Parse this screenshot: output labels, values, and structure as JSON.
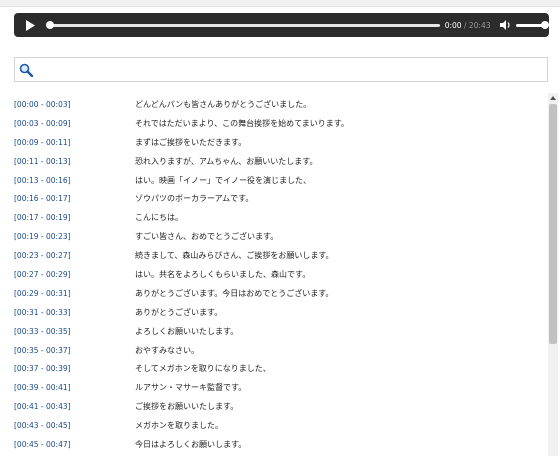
{
  "player": {
    "current_time": "0:00",
    "separator": " / ",
    "duration": "20:43",
    "progress": 0.0,
    "volume": 1.0
  },
  "search": {
    "placeholder": "",
    "value": ""
  },
  "transcript": [
    {
      "ts": "[00:00 - 00:03]",
      "text": "どんどんパンも皆さんありがとうございました。"
    },
    {
      "ts": "[00:03 - 00:09]",
      "text": "それではただいまより、この舞台挨拶を始めてまいります。"
    },
    {
      "ts": "[00:09 - 00:11]",
      "text": "まずはご挨拶をいただきます。"
    },
    {
      "ts": "[00:11 - 00:13]",
      "text": "恐れ入りますが、アムちゃん、お願いいたします。"
    },
    {
      "ts": "[00:13 - 00:16]",
      "text": "はい。映画「イノー」でイノー役を演じました、"
    },
    {
      "ts": "[00:16 - 00:17]",
      "text": "ゾウパツのボーカラーアムです。"
    },
    {
      "ts": "[00:17 - 00:19]",
      "text": "こんにちは。"
    },
    {
      "ts": "[00:19 - 00:23]",
      "text": "すごい皆さん、おめでとうございます。"
    },
    {
      "ts": "[00:23 - 00:27]",
      "text": "続きまして、森山みらびさん、ご挨拶をお願いします。"
    },
    {
      "ts": "[00:27 - 00:29]",
      "text": "はい。共名をよろしくもらいました、森山です。"
    },
    {
      "ts": "[00:29 - 00:31]",
      "text": "ありがとうございます。今日はおめでとうございます。"
    },
    {
      "ts": "[00:31 - 00:33]",
      "text": "ありがとうございます。"
    },
    {
      "ts": "[00:33 - 00:35]",
      "text": "よろしくお願いいたします。"
    },
    {
      "ts": "[00:35 - 00:37]",
      "text": "おやすみなさい。"
    },
    {
      "ts": "[00:37 - 00:39]",
      "text": "そしてメガホンを取りになりました、"
    },
    {
      "ts": "[00:39 - 00:41]",
      "text": "ルアサン・マサーキ監督です。"
    },
    {
      "ts": "[00:41 - 00:43]",
      "text": "ご挨拶をお願いいたします。"
    },
    {
      "ts": "[00:43 - 00:45]",
      "text": "メガホンを取りました。"
    },
    {
      "ts": "[00:45 - 00:47]",
      "text": "今日はよろしくお願いします。"
    }
  ]
}
